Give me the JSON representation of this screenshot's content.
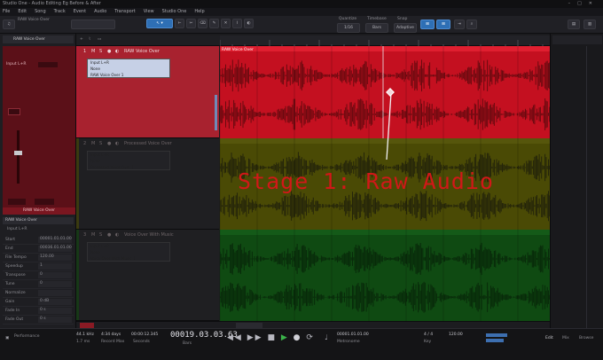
{
  "window": {
    "title": "Studio One - Audio Editing Eg Before & After"
  },
  "menu": [
    "File",
    "Edit",
    "Song",
    "Track",
    "Event",
    "Audio",
    "Transport",
    "View",
    "Studio One",
    "Help"
  ],
  "toolbar": {
    "quantize_label": "Quantize",
    "quantize_value": "1/16",
    "timebase_label": "Timebase",
    "timebase_value": "Bars",
    "snap_label": "Snap",
    "snap_value": "Adaptive"
  },
  "inspector": {
    "track_name": "RAW Voice Over",
    "input": "Input L+R",
    "output": "Main",
    "channel_name": "RAW Voice Over",
    "event_section": "RAW Voice Over",
    "input_label": "Input L+R",
    "rows": [
      {
        "label": "Start",
        "value": "00001.01.01.00"
      },
      {
        "label": "End",
        "value": "00036.01.01.00"
      },
      {
        "label": "File Tempo",
        "value": "120.00"
      },
      {
        "label": "Speedup",
        "value": "1"
      },
      {
        "label": "Transpose",
        "value": "0"
      },
      {
        "label": "Tune",
        "value": "0"
      },
      {
        "label": "Normalize",
        "value": ""
      },
      {
        "label": "Gain",
        "value": "0 dB"
      },
      {
        "label": "Fade In",
        "value": "0 s"
      },
      {
        "label": "Fade Out",
        "value": "0 s"
      }
    ]
  },
  "tracks": [
    {
      "number": "1",
      "name": "RAW Voice Over",
      "input": "Input L+R",
      "output": "None",
      "channel": "RAW Voice Over 1",
      "color": "#b01e32",
      "lane_color": "#c41020",
      "event_label": "RAW Voice Over"
    },
    {
      "number": "2",
      "name": "Processed Voice Over",
      "input": "Input L+R",
      "output": "None",
      "channel": "Processed Voice Over 1",
      "color": "#3a3a10",
      "lane_color": "#4a4a05",
      "event_label": ""
    },
    {
      "number": "3",
      "name": "Voice Over With Music",
      "input": "Input L+R",
      "output": "None",
      "channel": "Voice Over With Music 1",
      "color": "#173817",
      "lane_color": "#0f4a12",
      "event_label": ""
    }
  ],
  "overlay": {
    "text": "Stage 1: Raw Audio"
  },
  "transport": {
    "sample_rate": "44.1 kHz",
    "bit_depth": "1.7 ms",
    "record_max": "4:34 days",
    "record_max_label": "Record Max",
    "song_time": "00:00:12.345",
    "seconds_label": "Seconds",
    "position": "00019.03.03.63",
    "position_label": "Bars",
    "loop_start": "00001.01.01.00",
    "tempo": "120.00",
    "signature": "4 / 4",
    "metronome": "Metronome",
    "key": "Key",
    "edit_label": "Edit",
    "mix_label": "Mix",
    "browse_label": "Browse",
    "performance_label": "Performance"
  },
  "colors": {
    "accent": "#2e6fb5",
    "overlay_text": "#d11818"
  }
}
